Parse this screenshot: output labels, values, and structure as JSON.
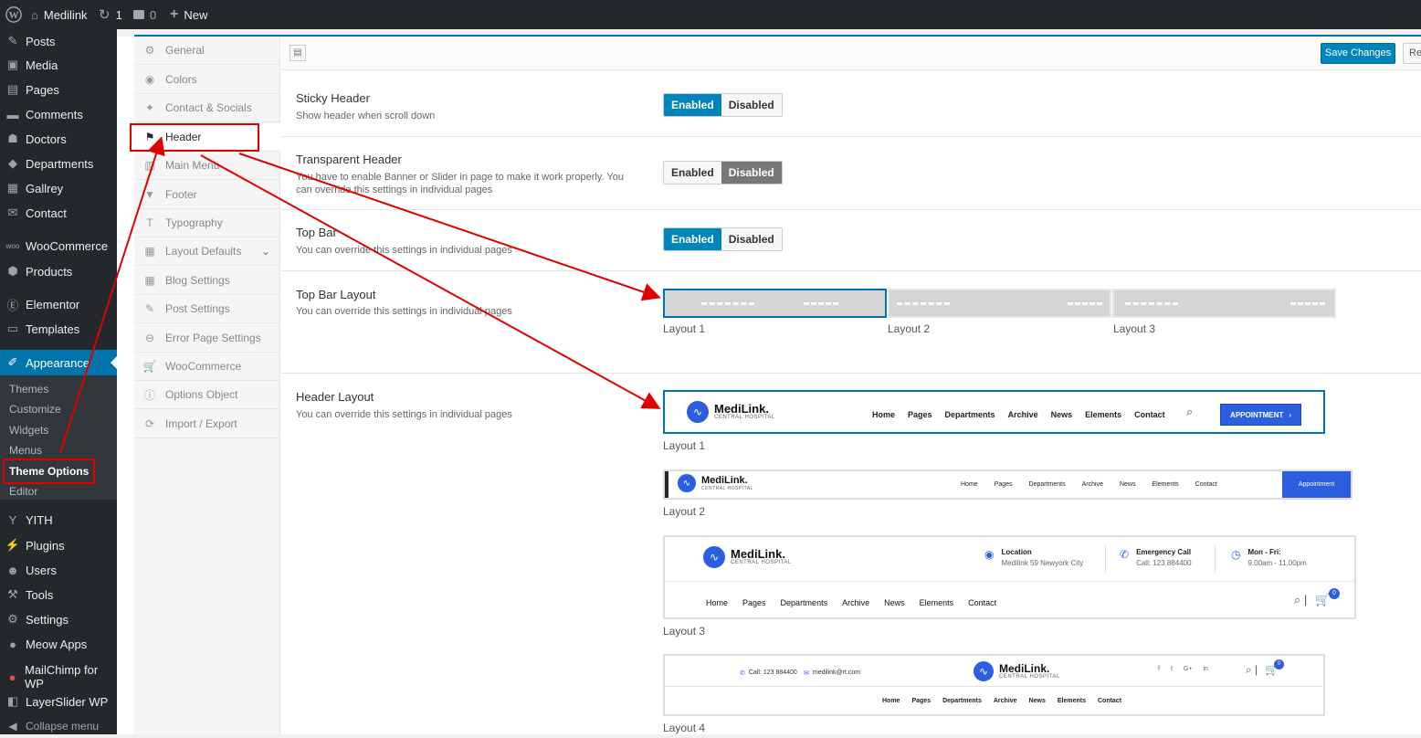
{
  "adminbar": {
    "site": "Medilink",
    "updates": "1",
    "comments": "0",
    "new": "New"
  },
  "menu": {
    "posts": "Posts",
    "media": "Media",
    "pages": "Pages",
    "comments": "Comments",
    "doctors": "Doctors",
    "departments": "Departments",
    "gallrey": "Gallrey",
    "contact": "Contact",
    "woocommerce": "WooCommerce",
    "products": "Products",
    "elementor": "Elementor",
    "templates": "Templates",
    "appearance": "Appearance",
    "yith": "YITH",
    "plugins": "Plugins",
    "users": "Users",
    "tools": "Tools",
    "settings": "Settings",
    "meow": "Meow Apps",
    "mailchimp": "MailChimp for WP",
    "layerslider": "LayerSlider WP",
    "collapse": "Collapse menu"
  },
  "submenu": {
    "themes": "Themes",
    "customize": "Customize",
    "widgets": "Widgets",
    "menus": "Menus",
    "theme_options": "Theme Options",
    "editor": "Editor"
  },
  "tabs": {
    "general": "General",
    "colors": "Colors",
    "contact": "Contact & Socials",
    "header": "Header",
    "main_menu": "Main Menu",
    "footer": "Footer",
    "typography": "Typography",
    "layout_defaults": "Layout Defaults",
    "blog": "Blog Settings",
    "post": "Post Settings",
    "error": "Error Page Settings",
    "woo": "WooCommerce",
    "options_object": "Options Object",
    "import": "Import / Export"
  },
  "toolbar": {
    "save": "Save Changes",
    "reset": "Re"
  },
  "options": {
    "sticky": {
      "title": "Sticky Header",
      "desc": "Show header when scroll down"
    },
    "transparent": {
      "title": "Transparent Header",
      "desc": "You have to enable Banner or Slider in page to make it work properly. You can override this settings in individual pages"
    },
    "topbar": {
      "title": "Top Bar",
      "desc": "You can override this settings in individual pages"
    },
    "topbar_layout": {
      "title": "Top Bar Layout",
      "desc": "You can override this settings in individual pages"
    },
    "header_layout": {
      "title": "Header Layout",
      "desc": "You can override this settings in individual pages"
    }
  },
  "toggle": {
    "enabled": "Enabled",
    "disabled": "Disabled"
  },
  "layouts": {
    "l1": "Layout 1",
    "l2": "Layout 2",
    "l3": "Layout 3",
    "l4": "Layout 4"
  },
  "preview": {
    "brand": "MediLink.",
    "brand_sub": "CENTRAL HOSPITAL",
    "nav": {
      "home": "Home",
      "pages": "Pages",
      "departments": "Departments",
      "archive": "Archive",
      "news": "News",
      "elements": "Elements",
      "contact": "Contact"
    },
    "appointment_caps": "APPOINTMENT",
    "appointment": "Appointment",
    "location": "Location",
    "location_val": "Medilink 59 Newyork City",
    "emergency": "Emergency Call",
    "emergency_val": "Call: 123 884400",
    "hours": "Mon - Fri:",
    "hours_val": "9.00am - 11.00pm",
    "cart_count": "0",
    "phone": "Call: 123 884400",
    "email": "medilink@rt.com"
  }
}
